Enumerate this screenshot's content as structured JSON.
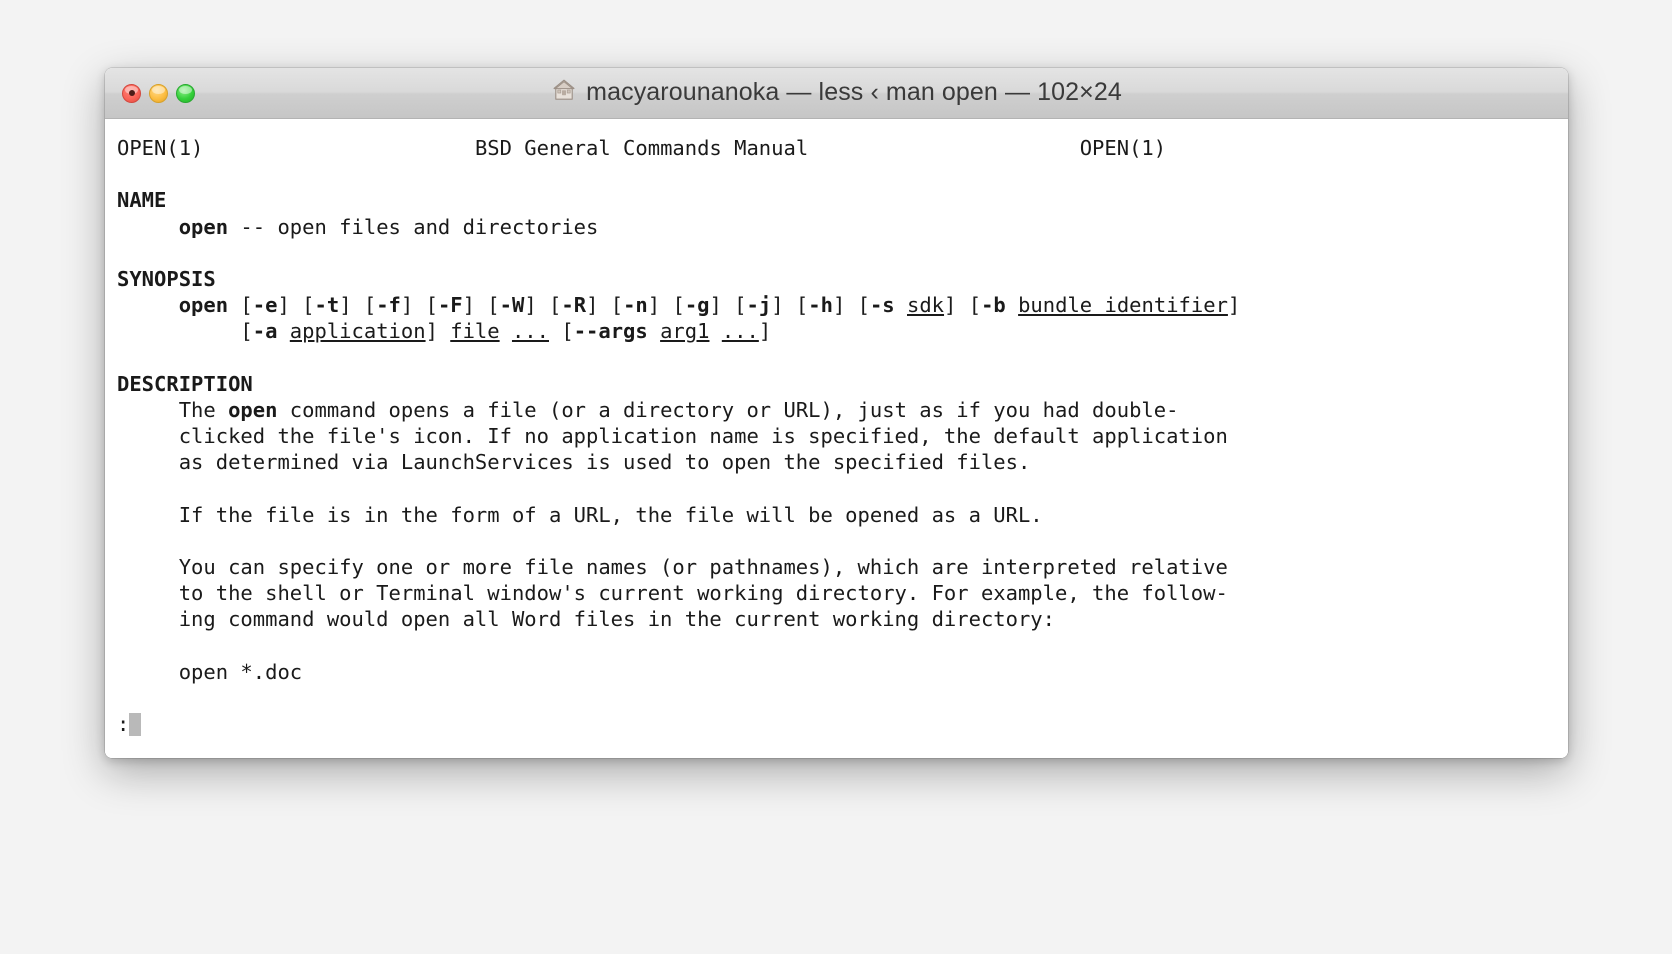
{
  "window": {
    "title": "macyarounanoka — less ‹ man open — 102×24",
    "icon": "house-icon",
    "traffic_lights": [
      {
        "name": "close",
        "color": "#fa6458",
        "label": "Close"
      },
      {
        "name": "minimize",
        "color": "#fdbe42",
        "label": "Minimize"
      },
      {
        "name": "zoom",
        "color": "#35d03a",
        "label": "Zoom"
      }
    ]
  },
  "terminal": {
    "columns": 102,
    "rows": 24,
    "prompt": ":",
    "cursor": "block",
    "lines": [
      {
        "id": "header",
        "segments": [
          {
            "text": "OPEN(1)",
            "style": "plain"
          },
          {
            "text": "                      ",
            "style": "plain"
          },
          {
            "text": "BSD General Commands Manual",
            "style": "plain"
          },
          {
            "text": "                      ",
            "style": "plain"
          },
          {
            "text": "OPEN(1)",
            "style": "plain"
          }
        ]
      },
      {
        "id": "blank1",
        "segments": []
      },
      {
        "id": "name-head",
        "segments": [
          {
            "text": "NAME",
            "style": "bold"
          }
        ]
      },
      {
        "id": "name-body",
        "segments": [
          {
            "text": "     ",
            "style": "plain"
          },
          {
            "text": "open",
            "style": "bold"
          },
          {
            "text": " -- open files and directories",
            "style": "plain"
          }
        ]
      },
      {
        "id": "blank2",
        "segments": []
      },
      {
        "id": "synopsis-head",
        "segments": [
          {
            "text": "SYNOPSIS",
            "style": "bold"
          }
        ]
      },
      {
        "id": "synopsis-1",
        "segments": [
          {
            "text": "     ",
            "style": "plain"
          },
          {
            "text": "open",
            "style": "bold"
          },
          {
            "text": " [",
            "style": "plain"
          },
          {
            "text": "-e",
            "style": "bold"
          },
          {
            "text": "] [",
            "style": "plain"
          },
          {
            "text": "-t",
            "style": "bold"
          },
          {
            "text": "] [",
            "style": "plain"
          },
          {
            "text": "-f",
            "style": "bold"
          },
          {
            "text": "] [",
            "style": "plain"
          },
          {
            "text": "-F",
            "style": "bold"
          },
          {
            "text": "] [",
            "style": "plain"
          },
          {
            "text": "-W",
            "style": "bold"
          },
          {
            "text": "] [",
            "style": "plain"
          },
          {
            "text": "-R",
            "style": "bold"
          },
          {
            "text": "] [",
            "style": "plain"
          },
          {
            "text": "-n",
            "style": "bold"
          },
          {
            "text": "] [",
            "style": "plain"
          },
          {
            "text": "-g",
            "style": "bold"
          },
          {
            "text": "] [",
            "style": "plain"
          },
          {
            "text": "-j",
            "style": "bold"
          },
          {
            "text": "] [",
            "style": "plain"
          },
          {
            "text": "-h",
            "style": "bold"
          },
          {
            "text": "] [",
            "style": "plain"
          },
          {
            "text": "-s",
            "style": "bold"
          },
          {
            "text": " ",
            "style": "plain"
          },
          {
            "text": "sdk",
            "style": "underline"
          },
          {
            "text": "] [",
            "style": "plain"
          },
          {
            "text": "-b",
            "style": "bold"
          },
          {
            "text": " ",
            "style": "plain"
          },
          {
            "text": "bundle identifier",
            "style": "underline"
          },
          {
            "text": "]",
            "style": "plain"
          }
        ]
      },
      {
        "id": "synopsis-2",
        "segments": [
          {
            "text": "          [",
            "style": "plain"
          },
          {
            "text": "-a",
            "style": "bold"
          },
          {
            "text": " ",
            "style": "plain"
          },
          {
            "text": "application",
            "style": "underline"
          },
          {
            "text": "] ",
            "style": "plain"
          },
          {
            "text": "file",
            "style": "underline"
          },
          {
            "text": " ",
            "style": "plain"
          },
          {
            "text": "...",
            "style": "underline"
          },
          {
            "text": " [",
            "style": "plain"
          },
          {
            "text": "--args",
            "style": "bold"
          },
          {
            "text": " ",
            "style": "plain"
          },
          {
            "text": "arg1",
            "style": "underline"
          },
          {
            "text": " ",
            "style": "plain"
          },
          {
            "text": "...",
            "style": "underline"
          },
          {
            "text": "]",
            "style": "plain"
          }
        ]
      },
      {
        "id": "blank3",
        "segments": []
      },
      {
        "id": "description-head",
        "segments": [
          {
            "text": "DESCRIPTION",
            "style": "bold"
          }
        ]
      },
      {
        "id": "desc-1",
        "segments": [
          {
            "text": "     The ",
            "style": "plain"
          },
          {
            "text": "open",
            "style": "bold"
          },
          {
            "text": " command opens a file (or a directory or URL), just as if you had double-",
            "style": "plain"
          }
        ]
      },
      {
        "id": "desc-2",
        "segments": [
          {
            "text": "     clicked the file's icon. If no application name is specified, the default application",
            "style": "plain"
          }
        ]
      },
      {
        "id": "desc-3",
        "segments": [
          {
            "text": "     as determined via LaunchServices is used to open the specified files.",
            "style": "plain"
          }
        ]
      },
      {
        "id": "blank4",
        "segments": []
      },
      {
        "id": "desc-4",
        "segments": [
          {
            "text": "     If the file is in the form of a URL, the file will be opened as a URL.",
            "style": "plain"
          }
        ]
      },
      {
        "id": "blank5",
        "segments": []
      },
      {
        "id": "desc-5",
        "segments": [
          {
            "text": "     You can specify one or more file names (or pathnames), which are interpreted relative",
            "style": "plain"
          }
        ]
      },
      {
        "id": "desc-6",
        "segments": [
          {
            "text": "     to the shell or Terminal window's current working directory. For example, the follow-",
            "style": "plain"
          }
        ]
      },
      {
        "id": "desc-7",
        "segments": [
          {
            "text": "     ing command would open all Word files in the current working directory:",
            "style": "plain"
          }
        ]
      },
      {
        "id": "blank6",
        "segments": []
      },
      {
        "id": "desc-8",
        "segments": [
          {
            "text": "     open *.doc",
            "style": "plain"
          }
        ]
      },
      {
        "id": "blank7",
        "segments": []
      }
    ]
  }
}
